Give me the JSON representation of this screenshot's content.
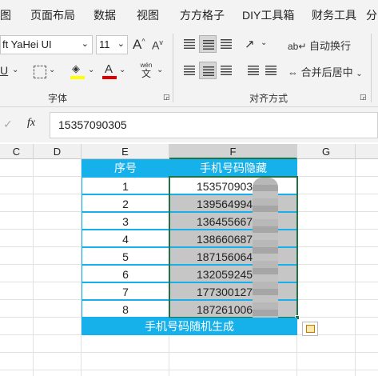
{
  "ribbon_tabs": [
    "图",
    "页面布局",
    "数据",
    "视图",
    "方方格子",
    "DIY工具箱",
    "财务工具",
    "分"
  ],
  "font": {
    "name": "ft YaHei UI",
    "size": "11",
    "group_label": "字体"
  },
  "font_buttons": {
    "grow": "A",
    "shrink": "A",
    "underline": "U",
    "font_color": "A",
    "wen_top": "wén",
    "wen_bottom": "文"
  },
  "alignment": {
    "group_label": "对齐方式",
    "wrap_text": "自动换行",
    "merge_center": "合并后居中"
  },
  "formula_bar": {
    "fx": "fx",
    "value": "15357090305"
  },
  "columns": [
    "C",
    "D",
    "E",
    "F",
    "G"
  ],
  "table": {
    "header_index": "序号",
    "header_phone": "手机号码隐藏",
    "rows": [
      {
        "index": "1",
        "phone": "15357090305"
      },
      {
        "index": "2",
        "phone": "13956499401"
      },
      {
        "index": "3",
        "phone": "13645566742"
      },
      {
        "index": "4",
        "phone": "13866068741"
      },
      {
        "index": "5",
        "phone": "18715606432"
      },
      {
        "index": "6",
        "phone": "13205924571"
      },
      {
        "index": "7",
        "phone": "17730012781"
      },
      {
        "index": "8",
        "phone": "18726100632"
      }
    ],
    "footer": "手机号码随机生成"
  },
  "colors": {
    "accent": "#16b1ea",
    "selection": "#c6c6c6",
    "excel_green": "#217346",
    "highlight_yellow": "#ffff00",
    "font_red": "#e00000"
  }
}
